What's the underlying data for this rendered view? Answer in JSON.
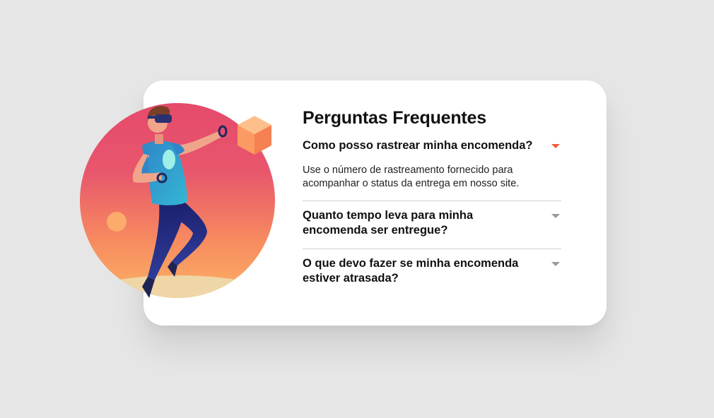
{
  "faq": {
    "title": "Perguntas Frequentes",
    "items": [
      {
        "question": "Como posso rastrear minha encomenda?",
        "answer": "Use o número de rastreamento fornecido para acompanhar o status da entrega em nosso site.",
        "expanded": true,
        "arrow_icon": "caret-down-icon"
      },
      {
        "question": "Quanto tempo leva para minha encomenda ser entregue?",
        "expanded": false,
        "arrow_icon": "caret-down-icon"
      },
      {
        "question": "O que devo fazer se minha encomenda estiver atrasada?",
        "expanded": false,
        "arrow_icon": "caret-down-icon"
      }
    ]
  },
  "colors": {
    "background": "#e6e6e6",
    "card": "#ffffff",
    "accent": "#f15b3d",
    "arrow_inactive": "#9b9b9b",
    "divider": "#cfcfcf"
  },
  "illustration": {
    "subject": "person-with-vr-headset"
  }
}
